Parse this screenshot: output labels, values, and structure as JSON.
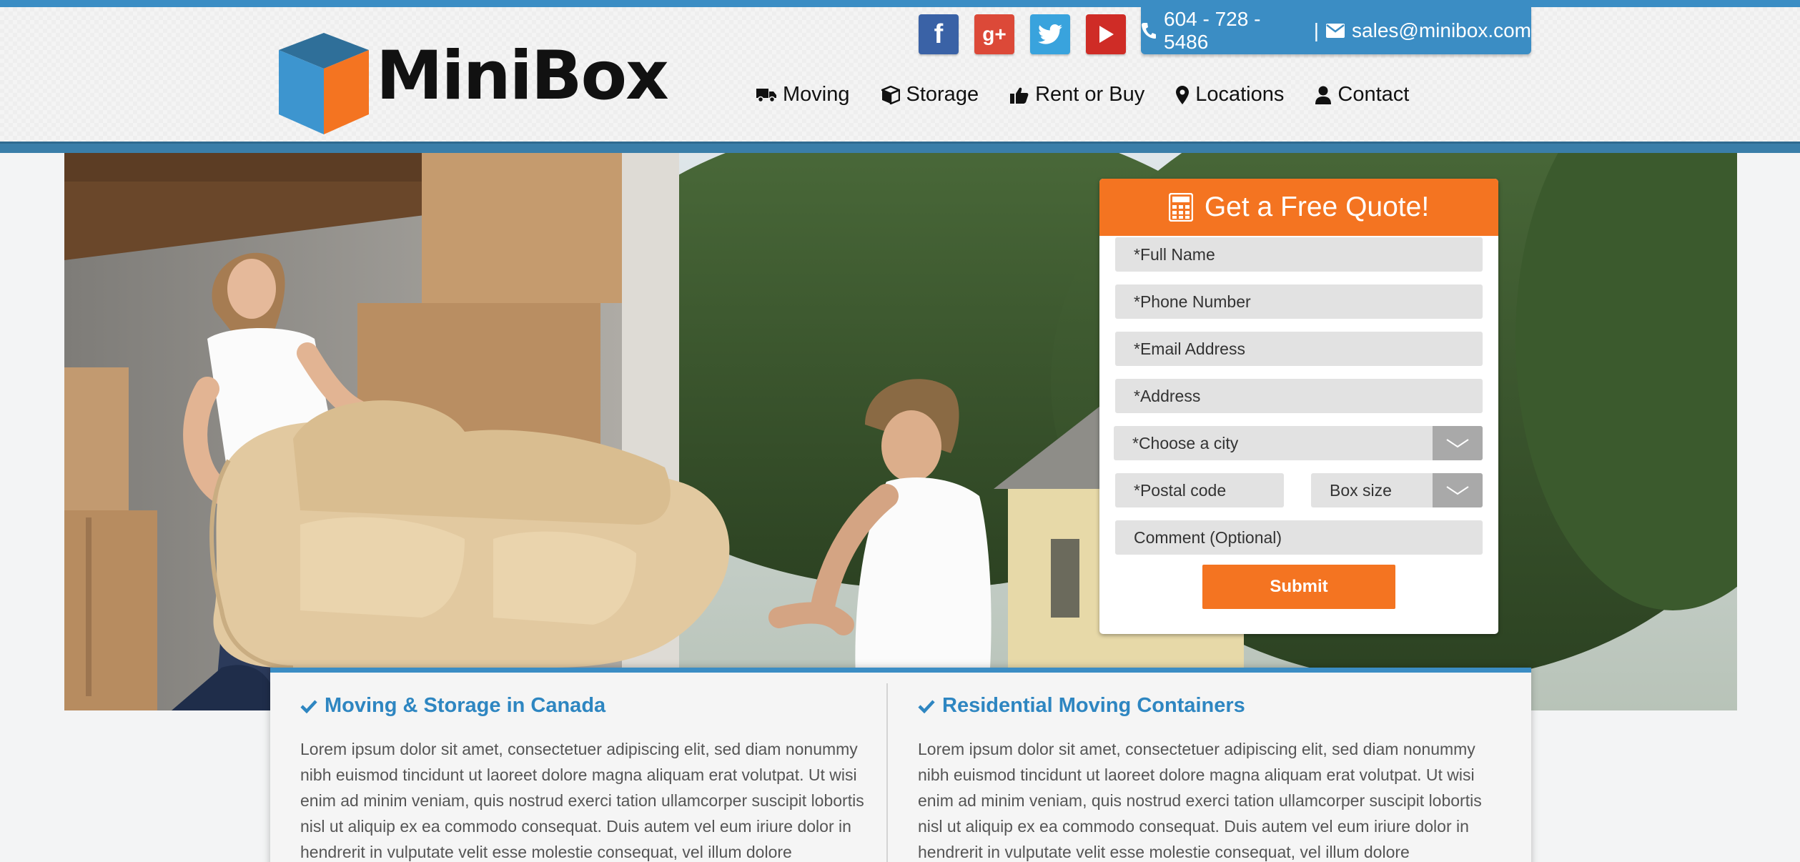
{
  "brand": {
    "name": "MiniBox"
  },
  "social": [
    {
      "name": "facebook",
      "glyph": "f"
    },
    {
      "name": "google-plus",
      "glyph": "g+"
    },
    {
      "name": "twitter",
      "glyph": ""
    },
    {
      "name": "youtube",
      "glyph": ""
    }
  ],
  "contact": {
    "phone": "604 - 728 - 5486",
    "separator": "|",
    "email": "sales@minibox.com"
  },
  "nav": [
    {
      "label": "Moving",
      "icon": "truck-icon"
    },
    {
      "label": "Storage",
      "icon": "box-icon"
    },
    {
      "label": "Rent or Buy",
      "icon": "thumbs-up-icon"
    },
    {
      "label": "Locations",
      "icon": "map-marker-icon"
    },
    {
      "label": "Contact",
      "icon": "user-icon"
    }
  ],
  "quote": {
    "title": "Get a Free Quote!",
    "fields": {
      "full_name": "*Full Name",
      "phone": "*Phone Number",
      "email": "*Email Address",
      "address": "*Address",
      "city": "*Choose a city",
      "postal": "*Postal code",
      "box_size": "Box size",
      "comment": "Comment (Optional)"
    },
    "submit": "Submit"
  },
  "sections": [
    {
      "title": "Moving & Storage in Canada",
      "body": "Lorem ipsum dolor sit amet, consectetuer adipiscing elit, sed diam nonummy nibh euismod tincidunt ut laoreet dolore magna aliquam erat volutpat. Ut wisi enim ad minim veniam, quis nostrud exerci tation ullamcorper suscipit lobortis nisl ut aliquip ex ea commodo consequat. Duis autem vel eum iriure dolor in hendrerit in vulputate velit esse molestie consequat, vel illum dolore"
    },
    {
      "title": "Residential Moving Containers",
      "body": "Lorem ipsum dolor sit amet, consectetuer adipiscing elit, sed diam nonummy nibh euismod tincidunt ut laoreet dolore magna aliquam erat volutpat. Ut wisi enim ad minim veniam, quis nostrud exerci tation ullamcorper suscipit lobortis nisl ut aliquip ex ea commodo consequat. Duis autem vel eum iriure dolor in hendrerit in vulputate velit esse molestie consequat, vel illum dolore"
    }
  ],
  "colors": {
    "accent_blue": "#3b8dc4",
    "accent_orange": "#f47421",
    "heading_blue": "#2e86c1"
  }
}
